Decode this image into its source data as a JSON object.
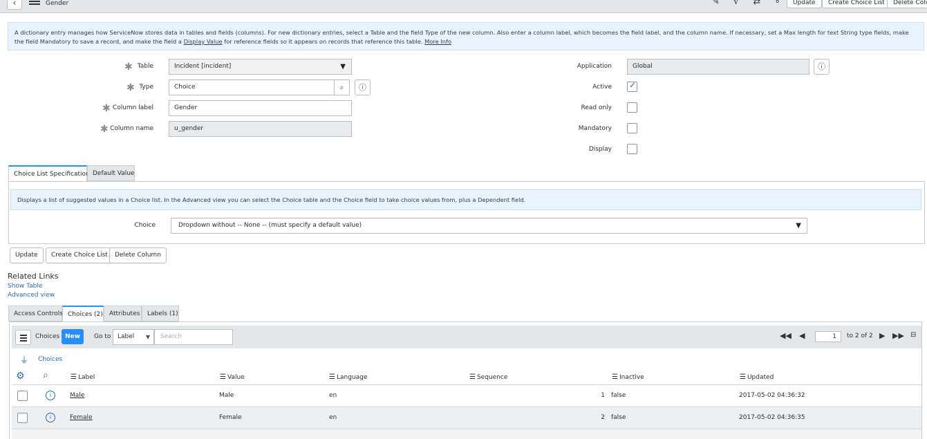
{
  "header": {
    "back_label": "‹",
    "subtitle": "Gender",
    "icons": [
      "paperclip-icon",
      "sqrt-icon",
      "sliders-icon",
      "more-icon"
    ],
    "icon_glyphs": "✎ √ ⇄ ∘∘∘",
    "buttons": {
      "update": "Update",
      "create_choice_list": "Create Choice List",
      "delete_column": "Delete Colum"
    }
  },
  "info": {
    "text_part1": "A dictionary entry manages how ServiceNow stores data in tables and fields (columns). For new dictionary entries, select a Table and the field Type of the new column. Also enter a column label, which becomes the field label, and the column name. If necessary, set a Max length for text String type fields, make the field Mandatory to save a record, and make the field a ",
    "display_value": "Display Value",
    "text_part2": " for reference fields so it appears on records that reference this table. ",
    "more_info": "More Info"
  },
  "form": {
    "table_label": "Table",
    "table_value": "Incident [incident]",
    "type_label": "Type",
    "type_value": "Choice",
    "column_label_label": "Column label",
    "column_label_value": "Gender",
    "column_name_label": "Column name",
    "column_name_value": "u_gender",
    "application_label": "Application",
    "application_value": "Global",
    "active_label": "Active",
    "read_only_label": "Read only",
    "mandatory_label": "Mandatory",
    "display_label": "Display",
    "active": true,
    "read_only": false,
    "mandatory": false,
    "display": false
  },
  "section_tabs": {
    "choice_spec": "Choice List Specification",
    "default_value": "Default Value"
  },
  "choice_section": {
    "info": "Displays a list of suggested values in a Choice list. In the Advanced view you can select the Choice table and the Choice field to take choice values from, plus a Dependent field.",
    "choice_label": "Choice",
    "choice_value": "Dropdown without -- None -- (must specify a default value)"
  },
  "bottom_buttons": {
    "update": "Update",
    "create_choice_list": "Create Choice List",
    "delete_column": "Delete Column"
  },
  "related_links": {
    "title": "Related Links",
    "show_table": "Show Table",
    "advanced_view": "Advanced view"
  },
  "related_tabs": [
    "Access Controls",
    "Choices (2)",
    "Attributes",
    "Labels (1)"
  ],
  "list": {
    "title": "Choices",
    "new_label": "New",
    "goto_label": "Go to",
    "goto_field": "Label",
    "search_placeholder": "Search",
    "page": "1",
    "page_of": "to 2 of 2",
    "breadcrumb": "Choices",
    "columns": [
      "Label",
      "Value",
      "Language",
      "Sequence",
      "Inactive",
      "Updated"
    ],
    "rows": [
      {
        "label": "Male",
        "value": "Male",
        "language": "en",
        "sequence": "1",
        "inactive": "false",
        "updated": "2017-05-02 04:36:32"
      },
      {
        "label": "Female",
        "value": "Female",
        "language": "en",
        "sequence": "2",
        "inactive": "false",
        "updated": "2017-05-02 04:36:35"
      }
    ]
  }
}
